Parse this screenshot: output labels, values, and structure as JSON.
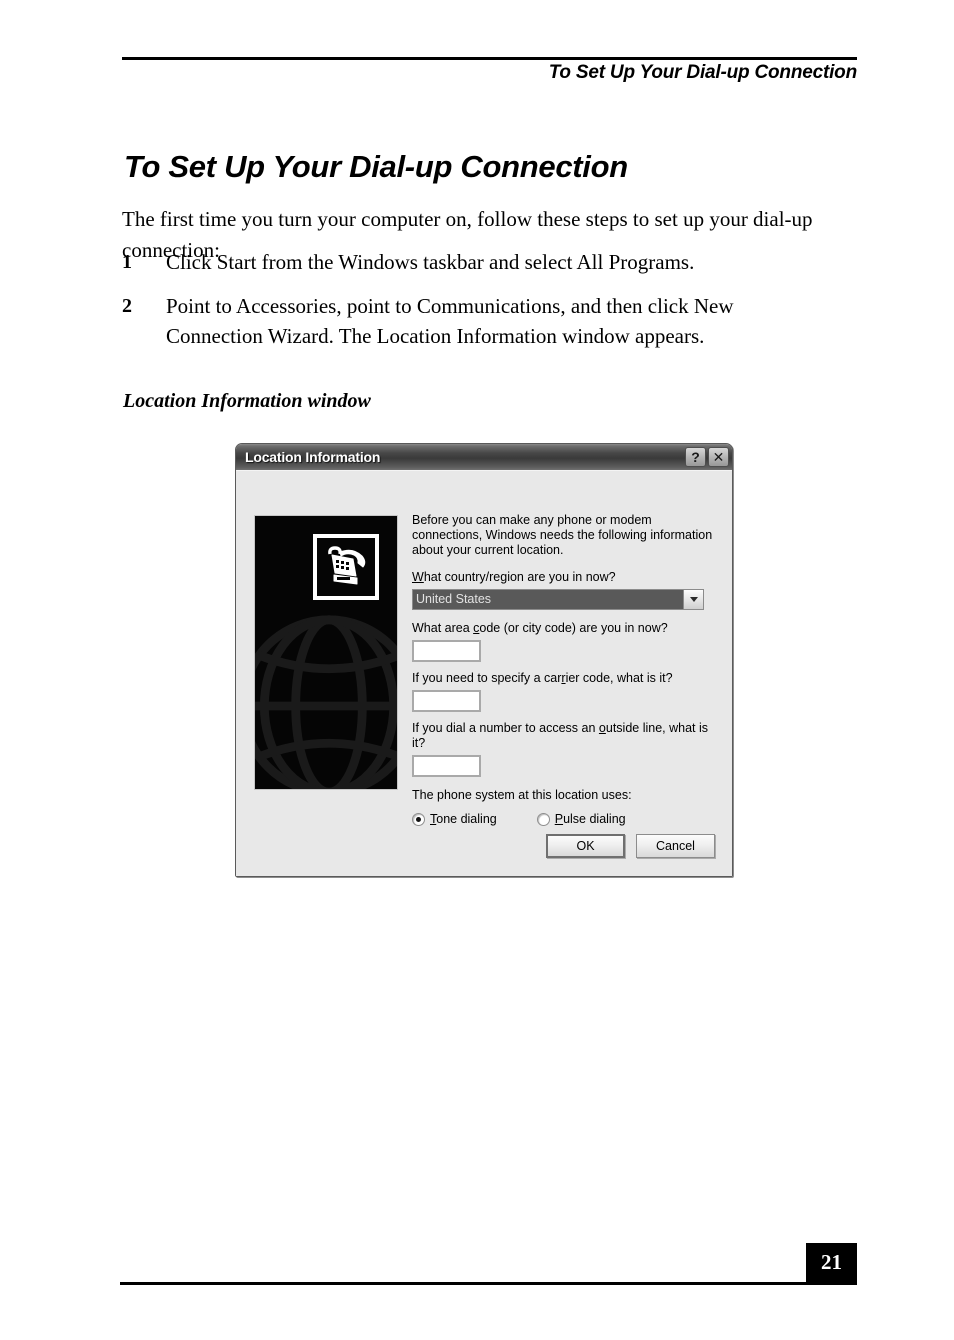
{
  "page": {
    "running_header": "To Set Up Your Dial-up Connection",
    "title": "To Set Up Your Dial-up Connection",
    "intro": "The first time you turn your computer on, follow these steps to set up your dial-up connection:",
    "steps": [
      {
        "num": "1",
        "text": "Click Start from the Windows taskbar and select All Programs."
      },
      {
        "num": "2",
        "text": "Point to Accessories, point to Communications, and then click New Connection Wizard. The Location Information window appears."
      }
    ],
    "figure_caption": "Location Information window",
    "page_number": "21"
  },
  "dialog": {
    "title": "Location Information",
    "titlebar_buttons": [
      {
        "name": "help",
        "glyph": "?"
      },
      {
        "name": "close",
        "glyph": "✕"
      }
    ],
    "artwork": {
      "icon_name": "telephone-icon",
      "background_name": "globe-wireframe"
    },
    "intro_text": "Before you can make any phone or modem connections, Windows needs the following information about your current location.",
    "country": {
      "label_pre": "",
      "label_accel": "W",
      "label_post": "hat country/region are you in now?",
      "value": "United States"
    },
    "area_code": {
      "label_pre": "What area ",
      "label_accel": "c",
      "label_post": "ode (or city code) are you in now?",
      "value": ""
    },
    "carrier_code": {
      "label_pre": "If you need to specify a car",
      "label_accel": "r",
      "label_post": "ier code, what is it?",
      "value": ""
    },
    "outside_line": {
      "label_pre": "If you dial a number to access an ",
      "label_accel": "o",
      "label_post": "utside line, what is it?",
      "value": ""
    },
    "phone_system": {
      "label": "The phone system at this location uses:",
      "options": [
        {
          "accel": "T",
          "rest": "one dialing",
          "selected": true
        },
        {
          "accel": "P",
          "rest": "ulse dialing",
          "selected": false
        }
      ]
    },
    "buttons": [
      {
        "label": "OK",
        "default": true
      },
      {
        "label": "Cancel",
        "default": false
      }
    ]
  },
  "colors": {
    "dialog_face": "#e8e8e8",
    "titlebar_dark": "#3a3a3a",
    "combo_selected": "#595959",
    "page_number_bg": "#000000"
  }
}
